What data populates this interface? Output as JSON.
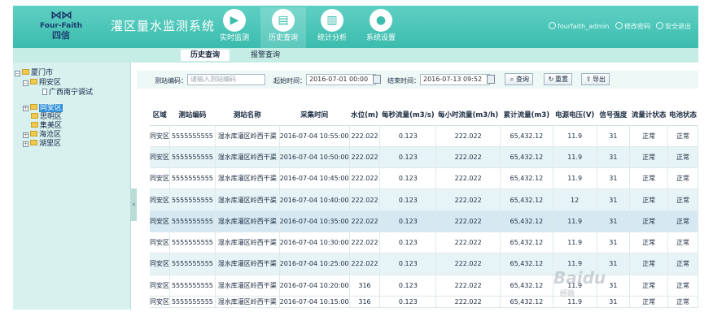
{
  "header": {
    "logo_brand": "Four-Faith",
    "logo_cn": "四信",
    "title": "灌区量水监测系统",
    "nav": [
      {
        "label": "实时监测",
        "icon": "camera-icon"
      },
      {
        "label": "历史查询",
        "icon": "document-icon"
      },
      {
        "label": "统计分析",
        "icon": "bar-chart-icon"
      },
      {
        "label": "系统设置",
        "icon": "user-icon"
      }
    ],
    "user": "fourfaith_admin",
    "change_password": "修改密码",
    "logout": "安全退出"
  },
  "subnav": {
    "tabs": [
      "历史查询",
      "报警查询"
    ]
  },
  "sidebar": {
    "tree": [
      {
        "label": "厦门市"
      },
      {
        "label": "翔安区"
      },
      {
        "label": "广西南宁调试"
      },
      {
        "label": "同安区"
      },
      {
        "label": "思明区"
      },
      {
        "label": "集美区"
      },
      {
        "label": "海沧区"
      },
      {
        "label": "湖里区"
      }
    ]
  },
  "filters": {
    "station_code_label": "测站编码：",
    "station_code_placeholder": "请输入测站编码",
    "start_time_label": "起始时间：",
    "start_time_value": "2016-07-01 00:00",
    "end_time_label": "结束时间：",
    "end_time_value": "2016-07-13 09:52",
    "query_button": "查询",
    "reset_button": "重置",
    "export_button": "导出"
  },
  "table": {
    "headers": [
      "区域",
      "测站编码",
      "测站名称",
      "采集时间",
      "水位(m)",
      "每秒流量(m3/s)",
      "每小时流量(m3/h)",
      "累计流量(m3)",
      "电源电压(V)",
      "信号强度",
      "流量计状态",
      "电池状态"
    ],
    "rows": [
      [
        "同安区",
        "5555555555",
        "湿水库灌区岭西干渠",
        "2016-07-04 10:55:00",
        "222.022",
        "0.123",
        "222.022",
        "65,432.12",
        "11.9",
        "31",
        "正常",
        "正常"
      ],
      [
        "同安区",
        "5555555555",
        "湿水库灌区岭西干渠",
        "2016-07-04 10:50:00",
        "222.022",
        "0.123",
        "222.022",
        "65,432.12",
        "11.9",
        "31",
        "正常",
        "正常"
      ],
      [
        "同安区",
        "5555555555",
        "湿水库灌区岭西干渠",
        "2016-07-04 10:45:00",
        "222.022",
        "0.123",
        "222.022",
        "65,432.12",
        "11.9",
        "31",
        "正常",
        "正常"
      ],
      [
        "同安区",
        "5555555555",
        "湿水库灌区岭西干渠",
        "2016-07-04 10:40:00",
        "222.022",
        "0.123",
        "222.022",
        "65,432.12",
        "12",
        "31",
        "正常",
        "正常"
      ],
      [
        "同安区",
        "5555555555",
        "湿水库灌区岭西干渠",
        "2016-07-04 10:35:00",
        "222.022",
        "0.123",
        "222.022",
        "65,432.12",
        "11.9",
        "31",
        "正常",
        "正常"
      ],
      [
        "同安区",
        "5555555555",
        "湿水库灌区岭西干渠",
        "2016-07-04 10:30:00",
        "222.022",
        "0.123",
        "222.022",
        "65,432.12",
        "11.9",
        "31",
        "正常",
        "正常"
      ],
      [
        "同安区",
        "5555555555",
        "湿水库灌区岭西干渠",
        "2016-07-04 10:25:00",
        "222.022",
        "0.123",
        "222.022",
        "65,432.12",
        "11.9",
        "31",
        "正常",
        "正常"
      ],
      [
        "同安区",
        "5555555555",
        "湿水库灌区岭西干渠",
        "2016-07-04 10:20:00",
        "316",
        "0.123",
        "222.022",
        "65,432.12",
        "11.9",
        "31",
        "正常",
        "正常"
      ],
      [
        "同安区",
        "5555555555",
        "湿水库灌区岭西干渠",
        "2016-07-04 10:15:00",
        "316",
        "0.123",
        "222.022",
        "65,432.12",
        "11.9",
        "31",
        "正常",
        "正常"
      ]
    ]
  },
  "watermark": {
    "brand": "Baidu",
    "sub": "经验"
  },
  "colors": {
    "header": "#3bbcae",
    "sidebar": "#d9f1ee",
    "row_alt": "#e7f4f7",
    "tree_selected": "#2f8fd8"
  }
}
